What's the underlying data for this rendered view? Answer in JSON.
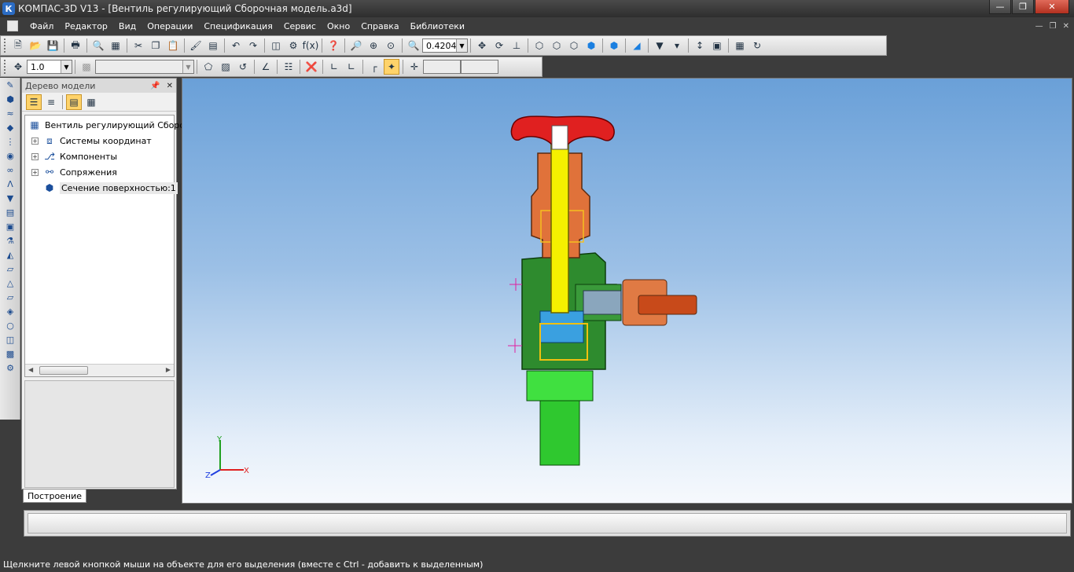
{
  "window": {
    "title": "КОМПАС-3D V13 - [Вентиль регулирующий Сборочная модель.a3d]",
    "controls": [
      "minimize-icon",
      "maximize-icon",
      "close-icon"
    ]
  },
  "menu": {
    "items": [
      "Файл",
      "Редактор",
      "Вид",
      "Операции",
      "Спецификация",
      "Сервис",
      "Окно",
      "Справка",
      "Библиотеки"
    ]
  },
  "toolbar": {
    "zoom_value": "0.4204",
    "step_value": "1.0"
  },
  "tree_panel": {
    "title": "Дерево модели",
    "root": "Вентиль регулирующий Сборочная модель",
    "nodes": [
      {
        "label": "Системы координат",
        "icon": "coordinate-systems-icon"
      },
      {
        "label": "Компоненты",
        "icon": "components-icon"
      },
      {
        "label": "Сопряжения",
        "icon": "mates-icon"
      },
      {
        "label": "Сечение поверхностью:1",
        "icon": "section-icon"
      }
    ],
    "tab": "Построение"
  },
  "viewport": {
    "axis_x": "X",
    "axis_y": "Y",
    "axis_z": "Z"
  },
  "status": {
    "hint": "Щелкните левой кнопкой мыши на объекте для его выделения (вместе с Ctrl - добавить к выделенным)"
  },
  "colors": {
    "handwheel": "#e02020",
    "bonnet": "#e0723a",
    "body": "#2e8b2e",
    "stem": "#f5f000",
    "fitting": "#40e040",
    "viewport_top": "#6aa0d8",
    "viewport_bottom": "#f6f9fd"
  }
}
